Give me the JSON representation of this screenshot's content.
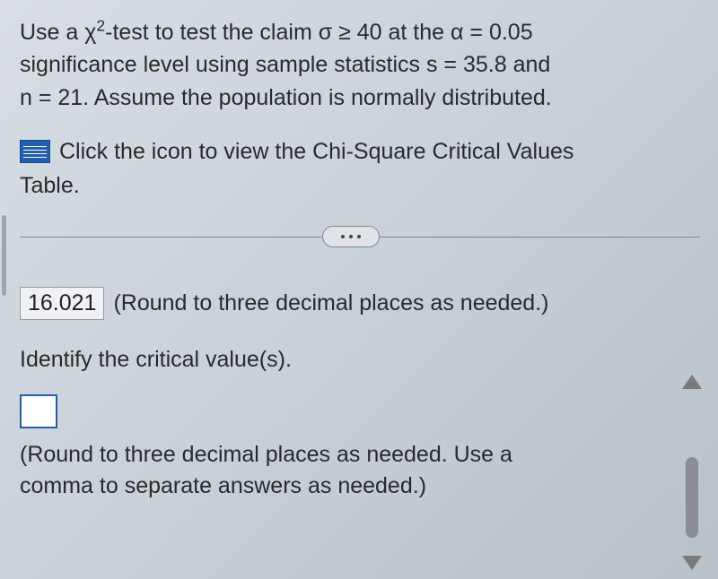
{
  "problem": {
    "line1_prefix": "Use a χ",
    "line1_sup": "2",
    "line1_rest": "-test to test the claim σ ≥ 40 at the α = 0.05",
    "line2": "significance level using sample statistics s = 35.8 and",
    "line3": "n = 21. Assume the population is normally distributed."
  },
  "link": {
    "text": "Click the icon to view the Chi-Square Critical Values",
    "text2": "Table."
  },
  "answer": {
    "value": "16.021",
    "hint": "(Round to three decimal places as needed.)"
  },
  "prompt": "Identify the critical value(s).",
  "note": {
    "line1": "(Round to three decimal places as needed. Use a",
    "line2": "comma to separate answers as needed.)"
  }
}
